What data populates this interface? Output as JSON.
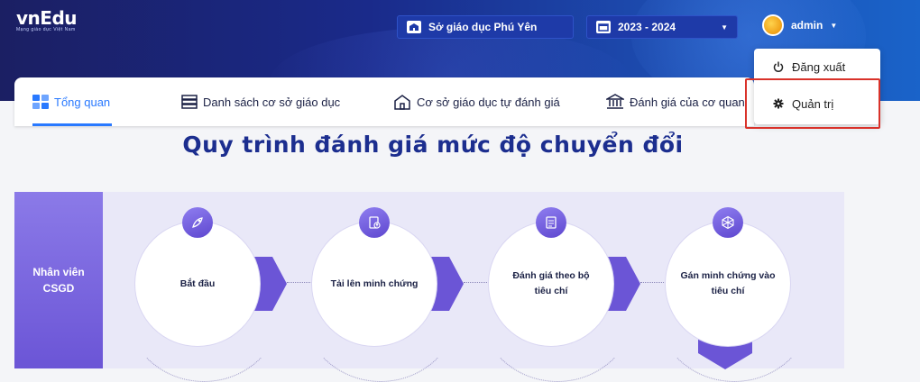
{
  "header": {
    "brand": "vnEdu",
    "slogan": "Mạng giáo dục Việt Nam",
    "department": "Sở giáo dục Phú Yên",
    "school_year": "2023 - 2024",
    "user": "admin"
  },
  "tabs": [
    {
      "label": "Tổng quan",
      "icon": "dashboard-icon",
      "active": true
    },
    {
      "label": "Danh sách cơ sở giáo dục",
      "icon": "list-icon"
    },
    {
      "label": "Cơ sở giáo dục tự đánh giá",
      "icon": "school-icon"
    },
    {
      "label": "Đánh giá của cơ quan",
      "icon": "government-building-icon"
    }
  ],
  "user_menu": {
    "logout": "Đăng xuất",
    "admin": "Quản trị"
  },
  "process": {
    "title": "Quy trình đánh giá mức độ chuyển đổi",
    "actor": "Nhân viên CSGD",
    "steps": [
      {
        "label": "Bắt đầu",
        "icon": "rocket-icon"
      },
      {
        "label": "Tải lên minh chứng",
        "icon": "upload-document-icon"
      },
      {
        "label": "Đánh giá theo bộ tiêu chí",
        "icon": "checklist-icon"
      },
      {
        "label": "Gán minh chứng vào tiêu chí",
        "icon": "network-icon"
      }
    ]
  },
  "colors": {
    "header_start": "#1b1f63",
    "header_end": "#1a63c9",
    "accent": "#2979ff",
    "title": "#1c2e8f",
    "step_purple": "#6b55d6",
    "highlight": "#d9322a"
  }
}
